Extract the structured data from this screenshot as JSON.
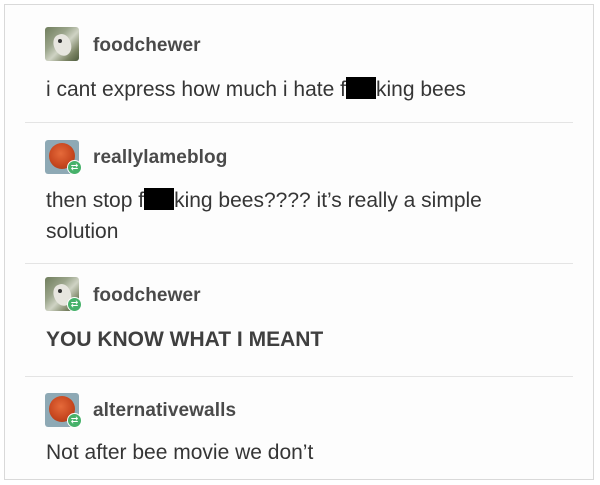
{
  "thread": {
    "posts": [
      {
        "username": "foodchewer",
        "avatar": "dog-photo-avatar",
        "reblog": false,
        "text_before": "i cant express how much i hate f",
        "text_after": "king bees",
        "censored": true
      },
      {
        "username": "reallylameblog",
        "avatar": "orange-disc-avatar",
        "reblog": true,
        "text_before": "then stop f",
        "text_after": "king bees???? it’s really a simple",
        "text_line2": "solution",
        "censored": true
      },
      {
        "username": "foodchewer",
        "avatar": "dog-photo-avatar",
        "reblog": true,
        "text": "YOU KNOW WHAT I MEANT"
      },
      {
        "username": "alternativewalls",
        "avatar": "orange-disc-avatar",
        "reblog": true,
        "text": "Not after bee movie we don’t"
      }
    ]
  },
  "colors": {
    "reblog_badge": "#46b16a",
    "censor_bar": "#000000"
  },
  "icons": {
    "reblog": "reblog-arrows-icon"
  }
}
